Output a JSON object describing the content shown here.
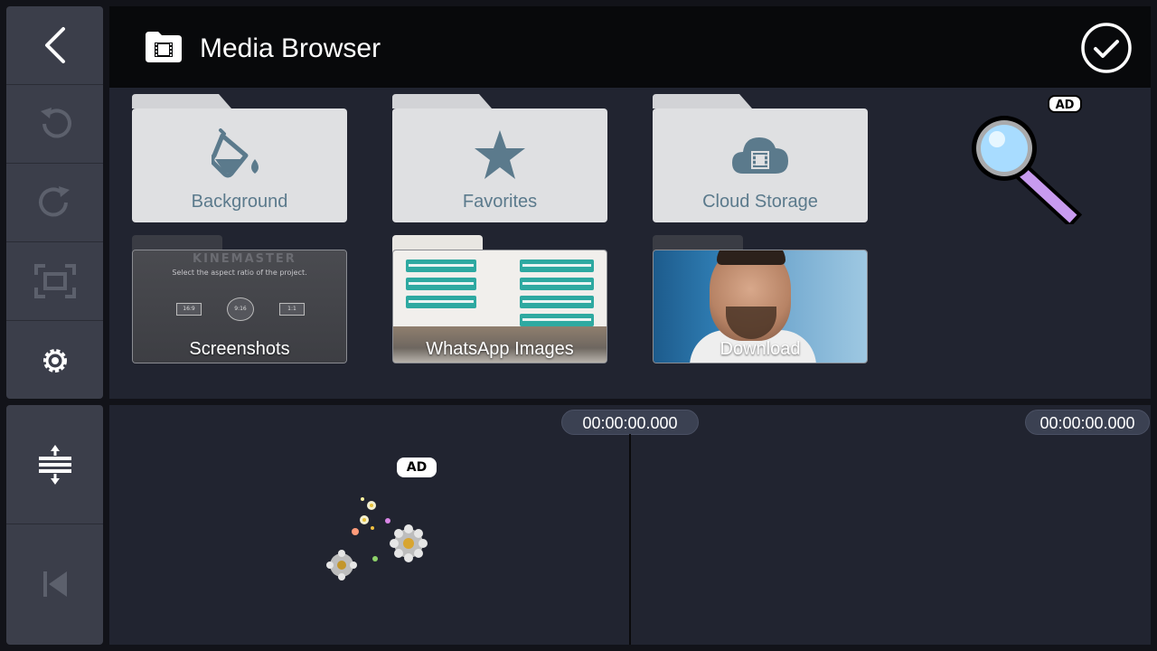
{
  "left_toolbar": {
    "top_buttons": [
      {
        "name": "back",
        "icon": "chevron-left-icon"
      },
      {
        "name": "undo",
        "icon": "undo-icon"
      },
      {
        "name": "redo",
        "icon": "redo-icon"
      },
      {
        "name": "fullscreen",
        "icon": "fullscreen-icon"
      },
      {
        "name": "settings",
        "icon": "gear-icon"
      }
    ],
    "bottom_buttons": [
      {
        "name": "timeline-expand",
        "icon": "timeline-expand-icon"
      },
      {
        "name": "jump-start",
        "icon": "skip-to-start-icon"
      }
    ]
  },
  "header": {
    "title": "Media Browser",
    "icon": "film-folder-icon",
    "confirm_icon": "checkmark-circle-icon"
  },
  "folders": [
    {
      "label": "Background",
      "icon": "paint-bucket-icon",
      "type": "icon"
    },
    {
      "label": "Favorites",
      "icon": "star-icon",
      "type": "icon"
    },
    {
      "label": "Cloud Storage",
      "icon": "cloud-film-icon",
      "type": "icon"
    },
    {
      "label": "Screenshots",
      "type": "thumbnail"
    },
    {
      "label": "WhatsApp Images",
      "type": "thumbnail"
    },
    {
      "label": "Download",
      "type": "thumbnail"
    }
  ],
  "screenshot_thumb": {
    "app_name": "KINEMASTER",
    "caption": "Select the aspect ratio of the project.",
    "ratios": [
      "16:9",
      "9:16",
      "1:1"
    ]
  },
  "ads": {
    "top_badge": "AD",
    "timeline_badge": "AD"
  },
  "timeline": {
    "current_time": "00:00:00.000",
    "total_time": "00:00:00.000"
  },
  "colors": {
    "folder_label": "#5b7a8c",
    "panel_bg": "#212430",
    "header_bg": "#08090b"
  }
}
